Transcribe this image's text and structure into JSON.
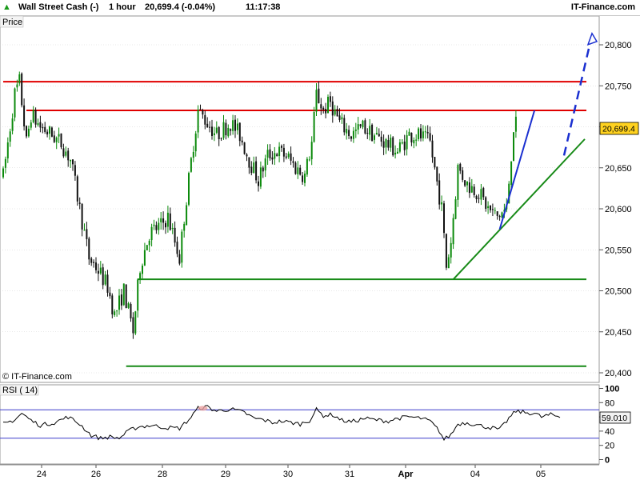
{
  "header": {
    "instrument": "Wall Street Cash (-)",
    "timeframe": "1 hour",
    "last_price": "20,699.4 (-0.04%)",
    "time": "11:17:38",
    "brand": "IT-Finance.com"
  },
  "colors": {
    "up_candle": "#0c8a0c",
    "down_candle": "#111111",
    "resistance": "#e00000",
    "support": "#178a17",
    "trend_blue": "#1a2fd0",
    "price_label_bg": "#ffd21f",
    "rsi_line": "#000000",
    "rsi_band": "#3c3ccc"
  },
  "chart_data": [
    {
      "type": "candlestick",
      "title": "Price",
      "watermark": "© IT-Finance.com",
      "ylim": [
        20400,
        20830
      ],
      "y_ticks": [
        20400,
        20450,
        20500,
        20550,
        20600,
        20650,
        20700,
        20750,
        20800
      ],
      "y_tick_labels": [
        "20,400",
        "20,450",
        "20,500",
        "20,550",
        "20,600",
        "20,650",
        "20,700",
        "20,750",
        "20,800"
      ],
      "x_tick_labels": [
        "24",
        "26",
        "28",
        "29",
        "30",
        "31",
        "Apr",
        "04",
        "05"
      ],
      "last_price_label": "20,699.4",
      "bars": 222,
      "waypoints": [
        [
          0,
          20640
        ],
        [
          5,
          20740
        ],
        [
          7,
          20755
        ],
        [
          10,
          20680
        ],
        [
          12,
          20715
        ],
        [
          16,
          20700
        ],
        [
          21,
          20690
        ],
        [
          25,
          20680
        ],
        [
          29,
          20660
        ],
        [
          33,
          20600
        ],
        [
          37,
          20540
        ],
        [
          41,
          20525
        ],
        [
          45,
          20505
        ],
        [
          48,
          20470
        ],
        [
          52,
          20500
        ],
        [
          56,
          20450
        ],
        [
          59,
          20530
        ],
        [
          63,
          20570
        ],
        [
          68,
          20580
        ],
        [
          71,
          20590
        ],
        [
          74,
          20560
        ],
        [
          76,
          20540
        ],
        [
          78,
          20590
        ],
        [
          82,
          20680
        ],
        [
          84,
          20720
        ],
        [
          88,
          20705
        ],
        [
          92,
          20690
        ],
        [
          98,
          20705
        ],
        [
          102,
          20690
        ],
        [
          106,
          20660
        ],
        [
          110,
          20635
        ],
        [
          114,
          20665
        ],
        [
          118,
          20670
        ],
        [
          122,
          20665
        ],
        [
          126,
          20650
        ],
        [
          130,
          20640
        ],
        [
          133,
          20680
        ],
        [
          135,
          20740
        ],
        [
          138,
          20720
        ],
        [
          141,
          20730
        ],
        [
          145,
          20705
        ],
        [
          150,
          20690
        ],
        [
          155,
          20700
        ],
        [
          160,
          20690
        ],
        [
          165,
          20680
        ],
        [
          170,
          20670
        ],
        [
          175,
          20690
        ],
        [
          179,
          20690
        ],
        [
          184,
          20680
        ],
        [
          189,
          20600
        ],
        [
          191,
          20530
        ],
        [
          193,
          20560
        ],
        [
          196,
          20650
        ],
        [
          200,
          20630
        ],
        [
          205,
          20620
        ],
        [
          209,
          20600
        ],
        [
          213,
          20590
        ],
        [
          217,
          20600
        ],
        [
          220,
          20700
        ],
        [
          225,
          20710
        ],
        [
          229,
          20690
        ],
        [
          232,
          20700
        ],
        [
          236,
          20690
        ],
        [
          240,
          20700
        ]
      ],
      "overlays": [
        {
          "kind": "resistance",
          "from": [
            0,
            20755
          ],
          "to": [
            252,
            20755
          ]
        },
        {
          "kind": "resistance",
          "from": [
            10,
            20720
          ],
          "to": [
            252,
            20720
          ]
        },
        {
          "kind": "support",
          "from": [
            58,
            20514
          ],
          "to": [
            252,
            20514
          ]
        },
        {
          "kind": "support",
          "from": [
            53,
            20408
          ],
          "to": [
            252,
            20408
          ]
        },
        {
          "kind": "support-trend",
          "from": [
            194,
            20514
          ],
          "to": [
            252,
            20685
          ]
        },
        {
          "kind": "blue-trend",
          "from": [
            214,
            20575
          ],
          "to": [
            229,
            20720
          ]
        },
        {
          "kind": "blue-projection",
          "from": [
            239,
            20665
          ],
          "to": [
            253,
            20808
          ]
        }
      ]
    },
    {
      "type": "line",
      "title": "RSI ( 14)",
      "ylim": [
        -10,
        110
      ],
      "y_ticks": [
        0,
        20,
        40,
        60,
        80,
        100
      ],
      "y_tick_labels": [
        "0",
        "20",
        "40",
        "60",
        "80",
        "100"
      ],
      "bands": [
        30,
        70
      ],
      "last_value_label": "59.010",
      "waypoints": [
        [
          0,
          50
        ],
        [
          5,
          56
        ],
        [
          8,
          65
        ],
        [
          12,
          55
        ],
        [
          16,
          48
        ],
        [
          22,
          52
        ],
        [
          28,
          60
        ],
        [
          33,
          50
        ],
        [
          38,
          34
        ],
        [
          42,
          30
        ],
        [
          46,
          32
        ],
        [
          50,
          30
        ],
        [
          54,
          40
        ],
        [
          58,
          46
        ],
        [
          64,
          48
        ],
        [
          70,
          45
        ],
        [
          76,
          44
        ],
        [
          80,
          56
        ],
        [
          84,
          72
        ],
        [
          88,
          74
        ],
        [
          92,
          68
        ],
        [
          98,
          71
        ],
        [
          104,
          66
        ],
        [
          108,
          58
        ],
        [
          112,
          56
        ],
        [
          116,
          52
        ],
        [
          120,
          54
        ],
        [
          124,
          52
        ],
        [
          128,
          50
        ],
        [
          132,
          55
        ],
        [
          135,
          70
        ],
        [
          138,
          62
        ],
        [
          142,
          63
        ],
        [
          146,
          55
        ],
        [
          150,
          53
        ],
        [
          156,
          58
        ],
        [
          160,
          56
        ],
        [
          166,
          54
        ],
        [
          170,
          58
        ],
        [
          175,
          60
        ],
        [
          180,
          58
        ],
        [
          184,
          54
        ],
        [
          188,
          40
        ],
        [
          190,
          28
        ],
        [
          193,
          35
        ],
        [
          196,
          50
        ],
        [
          200,
          52
        ],
        [
          205,
          48
        ],
        [
          210,
          45
        ],
        [
          214,
          42
        ],
        [
          218,
          58
        ],
        [
          221,
          68
        ],
        [
          225,
          66
        ],
        [
          229,
          65
        ],
        [
          232,
          60
        ],
        [
          236,
          63
        ],
        [
          240,
          60
        ]
      ]
    }
  ]
}
